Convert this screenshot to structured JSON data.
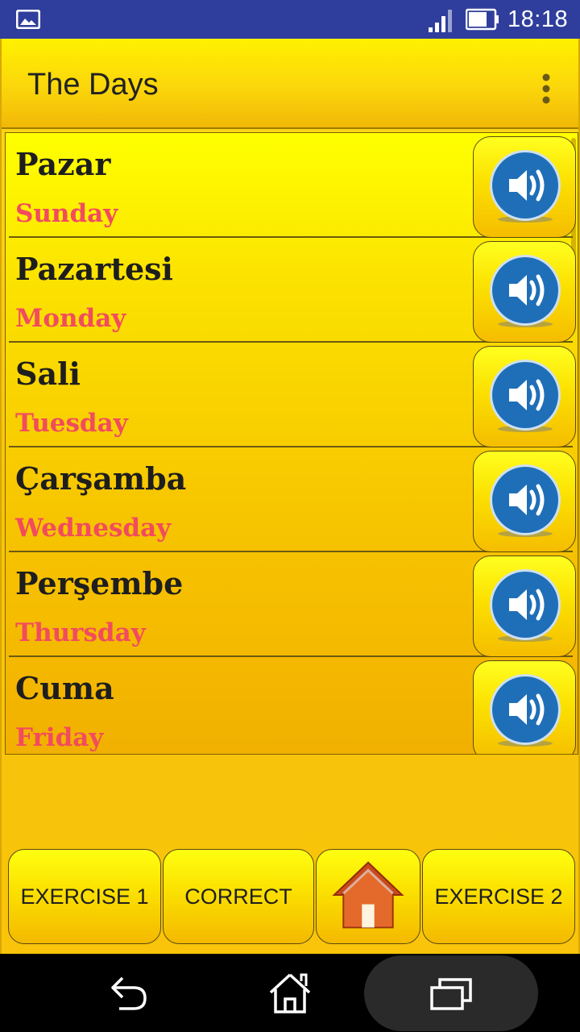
{
  "status_bar": {
    "time": "18:18",
    "icons": [
      "gallery-icon",
      "signal-icon",
      "battery-icon"
    ]
  },
  "toolbar": {
    "title": "The Days",
    "menu_icon": "more-vert-icon"
  },
  "days": [
    {
      "word": "Pazar",
      "translation": "Sunday"
    },
    {
      "word": "Pazartesi",
      "translation": "Monday"
    },
    {
      "word": "Sali",
      "translation": "Tuesday"
    },
    {
      "word": "Çarşamba",
      "translation": "Wednesday"
    },
    {
      "word": "Perşembe",
      "translation": "Thursday"
    },
    {
      "word": "Cuma",
      "translation": "Friday"
    }
  ],
  "bottom_bar": {
    "exercise1": "EXERCISE 1",
    "correct": "CORRECT",
    "home_icon": "home-icon",
    "exercise2": "EXERCISE 2"
  },
  "nav_bar": {
    "icons": [
      "back-icon",
      "home-icon",
      "recent-apps-icon"
    ]
  },
  "colors": {
    "status_bar": "#2f3e9c",
    "background": "#f7c40c",
    "word": "#1e1e1e",
    "translation": "#f24b5e",
    "sound_button": "#1f6fb8"
  }
}
